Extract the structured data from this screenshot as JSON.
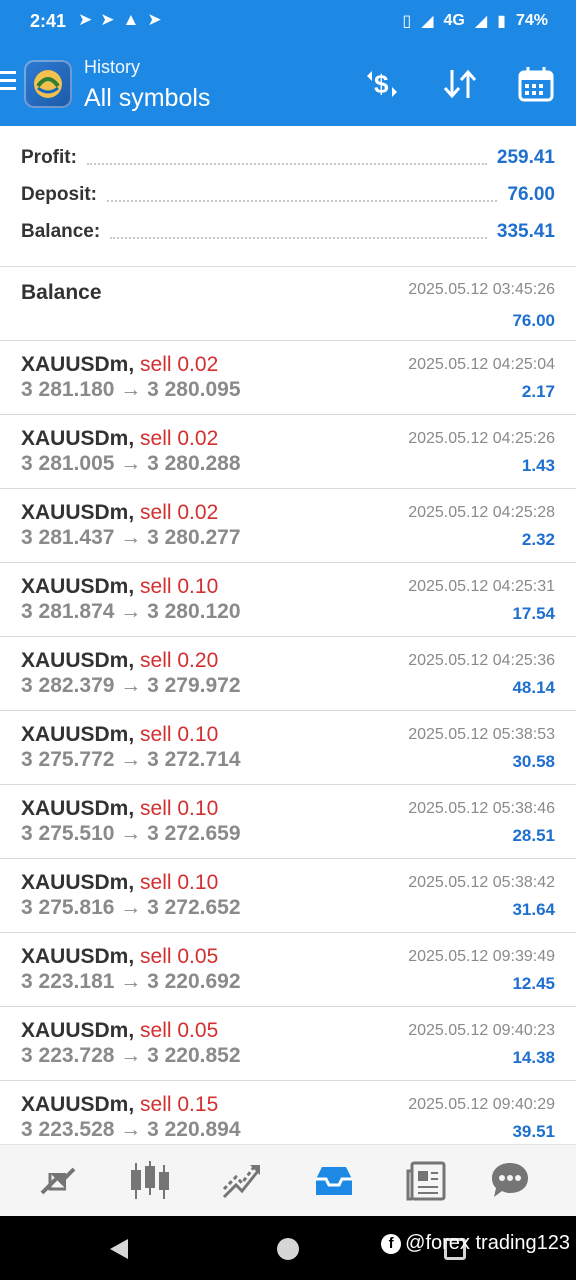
{
  "status_bar": {
    "time": "2:41",
    "network": "4G",
    "battery": "74%"
  },
  "app_bar": {
    "subtitle": "History",
    "title": "All symbols"
  },
  "summary": {
    "profit_label": "Profit:",
    "profit_value": "259.41",
    "deposit_label": "Deposit:",
    "deposit_value": "76.00",
    "balance_label": "Balance:",
    "balance_value": "335.41"
  },
  "balance_entry": {
    "label": "Balance",
    "date": "2025.05.12 03:45:26",
    "amount": "76.00"
  },
  "trades": [
    {
      "symbol": "XAUUSDm,",
      "action": "sell 0.02",
      "prices": "3 281.180 → 3 280.095",
      "date": "2025.05.12 04:25:04",
      "profit": "2.17"
    },
    {
      "symbol": "XAUUSDm,",
      "action": "sell 0.02",
      "prices": "3 281.005 → 3 280.288",
      "date": "2025.05.12 04:25:26",
      "profit": "1.43"
    },
    {
      "symbol": "XAUUSDm,",
      "action": "sell 0.02",
      "prices": "3 281.437 → 3 280.277",
      "date": "2025.05.12 04:25:28",
      "profit": "2.32"
    },
    {
      "symbol": "XAUUSDm,",
      "action": "sell 0.10",
      "prices": "3 281.874 → 3 280.120",
      "date": "2025.05.12 04:25:31",
      "profit": "17.54"
    },
    {
      "symbol": "XAUUSDm,",
      "action": "sell 0.20",
      "prices": "3 282.379 → 3 279.972",
      "date": "2025.05.12 04:25:36",
      "profit": "48.14"
    },
    {
      "symbol": "XAUUSDm,",
      "action": "sell 0.10",
      "prices": "3 275.772 → 3 272.714",
      "date": "2025.05.12 05:38:53",
      "profit": "30.58"
    },
    {
      "symbol": "XAUUSDm,",
      "action": "sell 0.10",
      "prices": "3 275.510 → 3 272.659",
      "date": "2025.05.12 05:38:46",
      "profit": "28.51"
    },
    {
      "symbol": "XAUUSDm,",
      "action": "sell 0.10",
      "prices": "3 275.816 → 3 272.652",
      "date": "2025.05.12 05:38:42",
      "profit": "31.64"
    },
    {
      "symbol": "XAUUSDm,",
      "action": "sell 0.05",
      "prices": "3 223.181 → 3 220.692",
      "date": "2025.05.12 09:39:49",
      "profit": "12.45"
    },
    {
      "symbol": "XAUUSDm,",
      "action": "sell 0.05",
      "prices": "3 223.728 → 3 220.852",
      "date": "2025.05.12 09:40:23",
      "profit": "14.38"
    },
    {
      "symbol": "XAUUSDm,",
      "action": "sell 0.15",
      "prices": "3 223.528 → 3 220.894",
      "date": "2025.05.12 09:40:29",
      "profit": "39.51"
    }
  ],
  "bottom_nav": [
    "quotes-icon",
    "chart-icon",
    "trade-icon",
    "history-icon",
    "news-icon",
    "chat-icon"
  ],
  "watermark": "@forex trading123",
  "colors": {
    "accent": "#1e88e5",
    "sell": "#d32f2f",
    "profit": "#1e6fcf"
  }
}
